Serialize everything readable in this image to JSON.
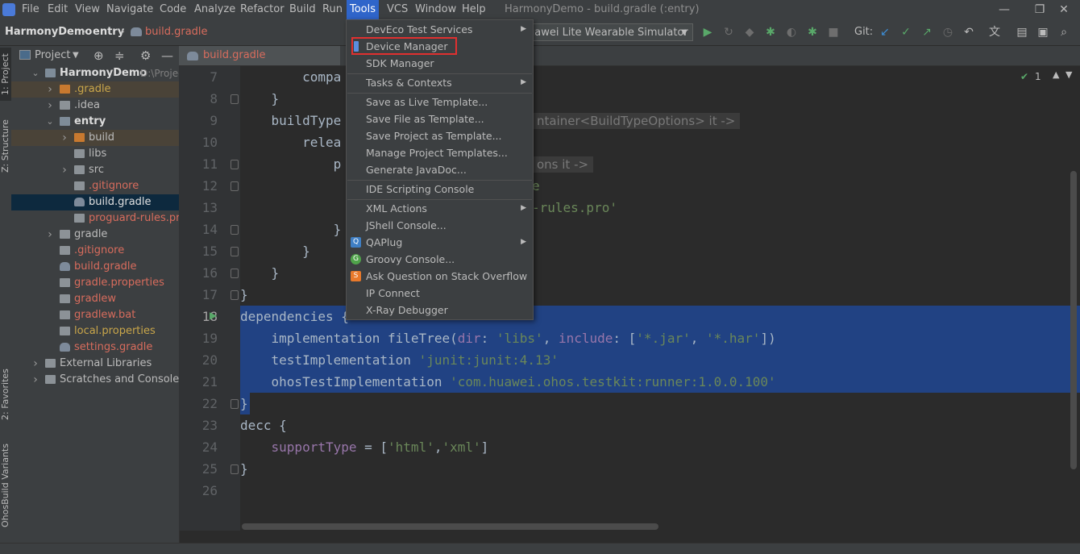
{
  "menubar": {
    "items": [
      "File",
      "Edit",
      "View",
      "Navigate",
      "Code",
      "Analyze",
      "Refactor",
      "Build",
      "Run",
      "Tools",
      "VCS",
      "Window",
      "Help"
    ],
    "window_title": "HarmonyDemo - build.gradle (:entry)",
    "controls": {
      "minimize": "—",
      "restore": "❐",
      "close": "✕"
    }
  },
  "navbar": {
    "breadcrumbs": [
      "HarmonyDemo",
      "entry",
      "build.gradle"
    ],
    "run_config": "uawei Lite Wearable Simulator",
    "git_label": "Git:"
  },
  "left_stripe": {
    "tabs": [
      "1: Project",
      "Z: Structure",
      "2: Favorites",
      "OhosBuild Variants"
    ]
  },
  "project_panel": {
    "title": "Project",
    "tree": [
      {
        "label": "HarmonyDemo",
        "suffix": "D:\\Project_(",
        "depth": 0,
        "expanded": true,
        "icon": "module-folder"
      },
      {
        "label": ".gradle",
        "depth": 1,
        "expanded": false,
        "icon": "folder-orange"
      },
      {
        "label": ".idea",
        "depth": 1,
        "expanded": false,
        "icon": "folder"
      },
      {
        "label": "entry",
        "depth": 1,
        "expanded": true,
        "icon": "module-folder"
      },
      {
        "label": "build",
        "depth": 2,
        "expanded": false,
        "icon": "folder-orange"
      },
      {
        "label": "libs",
        "depth": 2,
        "icon": "folder"
      },
      {
        "label": "src",
        "depth": 2,
        "expanded": false,
        "icon": "folder"
      },
      {
        "label": ".gitignore",
        "depth": 2,
        "icon": "file"
      },
      {
        "label": "build.gradle",
        "depth": 2,
        "icon": "gradle-file"
      },
      {
        "label": "proguard-rules.pro",
        "depth": 2,
        "icon": "file"
      },
      {
        "label": "gradle",
        "depth": 1,
        "expanded": false,
        "icon": "folder"
      },
      {
        "label": ".gitignore",
        "depth": 1,
        "icon": "file"
      },
      {
        "label": "build.gradle",
        "depth": 1,
        "icon": "gradle-file"
      },
      {
        "label": "gradle.properties",
        "depth": 1,
        "icon": "file"
      },
      {
        "label": "gradlew",
        "depth": 1,
        "icon": "file"
      },
      {
        "label": "gradlew.bat",
        "depth": 1,
        "icon": "file"
      },
      {
        "label": "local.properties",
        "depth": 1,
        "icon": "file"
      },
      {
        "label": "settings.gradle",
        "depth": 1,
        "icon": "gradle-file"
      },
      {
        "label": "External Libraries",
        "depth": 0,
        "expanded": false,
        "icon": "library"
      },
      {
        "label": "Scratches and Consoles",
        "depth": 0,
        "expanded": false,
        "icon": "scratch"
      }
    ]
  },
  "editor": {
    "tab_label": "build.gradle (HarmonyDemo)",
    "inspection_count": "1",
    "line_numbers": [
      "7",
      "8",
      "9",
      "10",
      "11",
      "12",
      "13",
      "14",
      "15",
      "16",
      "17",
      "18",
      "19",
      "20",
      "21",
      "22",
      "23",
      "24",
      "25",
      "26"
    ],
    "lines": {
      "l7": "        compa",
      "l8": "    }",
      "l9a": "    buildType",
      "l9hint": "ntainer<BuildTypeOptions> it ->",
      "l10": "        relea",
      "l11a": "            p",
      "l11hint": "ons it ->",
      "l12": "e",
      "l13": "-rules.pro'",
      "l14": "            }",
      "l15": "        }",
      "l16": "    }",
      "l17": "}",
      "l18": "dependencies {",
      "l19_kw": "    implementation fileTree(",
      "l19_dir": "dir",
      "l19_p1": ": ",
      "l19_s1": "'libs'",
      "l19_p2": ", ",
      "l19_inc": "include",
      "l19_p3": ": [",
      "l19_s2": "'*.jar'",
      "l19_p4": ", ",
      "l19_s3": "'*.har'",
      "l19_p5": "])",
      "l20_kw": "    testImplementation ",
      "l20_s": "'junit:junit:4.13'",
      "l21_kw": "    ohosTestImplementation ",
      "l21_s": "'com.huawei.ohos.testkit:runner:1.0.0.100'",
      "l22": "}",
      "l23": "decc {",
      "l24_a": "    ",
      "l24_b": "supportType",
      "l24_c": " = [",
      "l24_s1": "'html'",
      "l24_d": ",",
      "l24_s2": "'xml'",
      "l24_e": "]",
      "l25": "}"
    }
  },
  "tools_menu": {
    "items": [
      {
        "label": "DevEco Test Services",
        "submenu": true
      },
      {
        "label": "Device Manager",
        "highlighted": true
      },
      {
        "label": "SDK Manager"
      },
      {
        "label": "Tasks & Contexts",
        "submenu": true
      },
      {
        "label": "Save as Live Template..."
      },
      {
        "label": "Save File as Template..."
      },
      {
        "label": "Save Project as Template..."
      },
      {
        "label": "Manage Project Templates..."
      },
      {
        "label": "Generate JavaDoc..."
      },
      {
        "label": "IDE Scripting Console"
      },
      {
        "label": "XML Actions",
        "submenu": true
      },
      {
        "label": "JShell Console..."
      },
      {
        "label": "QAPlug",
        "submenu": true
      },
      {
        "label": "Groovy Console..."
      },
      {
        "label": "Ask Question on Stack Overflow"
      },
      {
        "label": "IP Connect"
      },
      {
        "label": "X-Ray Debugger"
      }
    ]
  },
  "colors": {
    "accent": "#2f65ca",
    "highlight_box": "#e03030",
    "selection": "#214283",
    "string": "#6a8759",
    "named_arg": "#9876aa"
  }
}
